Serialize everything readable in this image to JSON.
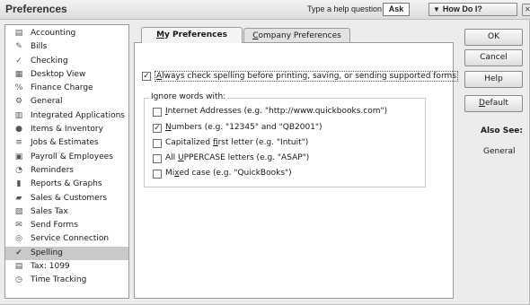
{
  "window": {
    "title": "Preferences",
    "help_hint": "Type a help question",
    "ask_label": "Ask",
    "how_do_i_label": "How Do I?"
  },
  "categories": [
    {
      "label": "Accounting",
      "icon": "ledger-icon",
      "glyph": "▤"
    },
    {
      "label": "Bills",
      "icon": "bills-icon",
      "glyph": "✎"
    },
    {
      "label": "Checking",
      "icon": "checking-icon",
      "glyph": "✓"
    },
    {
      "label": "Desktop View",
      "icon": "desktop-icon",
      "glyph": "▦"
    },
    {
      "label": "Finance Charge",
      "icon": "finance-charge-icon",
      "glyph": "%"
    },
    {
      "label": "General",
      "icon": "general-icon",
      "glyph": "⚙"
    },
    {
      "label": "Integrated Applications",
      "icon": "integrated-apps-icon",
      "glyph": "▥"
    },
    {
      "label": "Items & Inventory",
      "icon": "inventory-icon",
      "glyph": "●"
    },
    {
      "label": "Jobs & Estimates",
      "icon": "jobs-icon",
      "glyph": "≡"
    },
    {
      "label": "Payroll & Employees",
      "icon": "payroll-icon",
      "glyph": "▣"
    },
    {
      "label": "Reminders",
      "icon": "reminders-icon",
      "glyph": "◔"
    },
    {
      "label": "Reports & Graphs",
      "icon": "reports-icon",
      "glyph": "▮"
    },
    {
      "label": "Sales & Customers",
      "icon": "sales-icon",
      "glyph": "▰"
    },
    {
      "label": "Sales Tax",
      "icon": "sales-tax-icon",
      "glyph": "▧"
    },
    {
      "label": "Send Forms",
      "icon": "send-forms-icon",
      "glyph": "✉"
    },
    {
      "label": "Service Connection",
      "icon": "service-connection-icon",
      "glyph": "◎"
    },
    {
      "label": "Spelling",
      "icon": "spelling-icon",
      "glyph": "✔"
    },
    {
      "label": "Tax: 1099",
      "icon": "tax-1099-icon",
      "glyph": "▤"
    },
    {
      "label": "Time Tracking",
      "icon": "time-tracking-icon",
      "glyph": "◷"
    }
  ],
  "selected_category": "Spelling",
  "tabs": {
    "my_prefix": "",
    "my_mnemonic": "M",
    "my_rest": "y Preferences",
    "company_prefix": "",
    "company_mnemonic": "C",
    "company_rest": "ompany Preferences"
  },
  "spelling": {
    "always_check": {
      "checked": true,
      "mnemonic": "A",
      "rest": "lways check spelling before printing, saving, or sending supported forms"
    },
    "ignore_group_label": "Ignore words with:",
    "options": [
      {
        "checked": false,
        "pre": "",
        "mn": "I",
        "post": "nternet Addresses (e.g. \"http://www.quickbooks.com\")"
      },
      {
        "checked": true,
        "pre": "",
        "mn": "N",
        "post": "umbers (e.g. \"12345\" and \"QB2001\")"
      },
      {
        "checked": false,
        "pre": "Capitalized ",
        "mn": "f",
        "post": "irst letter (e.g. \"Intuit\")"
      },
      {
        "checked": false,
        "pre": "All ",
        "mn": "U",
        "post": "PPERCASE letters (e.g. \"ASAP\")"
      },
      {
        "checked": false,
        "pre": "Mi",
        "mn": "x",
        "post": "ed case (e.g. \"QuickBooks\")"
      }
    ]
  },
  "buttons": {
    "ok": "OK",
    "cancel": "Cancel",
    "help": "Help",
    "default_mnemonic": "D",
    "default_rest": "efault"
  },
  "also_see": {
    "heading": "Also See:",
    "links": [
      "General"
    ]
  }
}
